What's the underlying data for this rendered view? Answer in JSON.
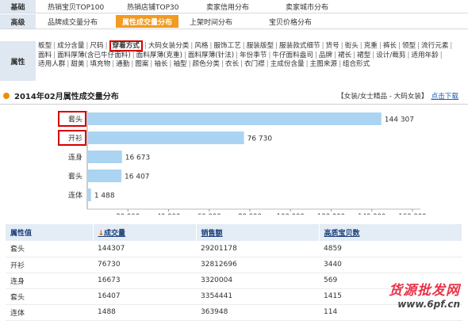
{
  "nav": {
    "row1": {
      "label": "基础",
      "items": [
        "热销宝贝TOP100",
        "热销店铺TOP30",
        "卖家信用分布",
        "卖家城市分布"
      ]
    },
    "row2": {
      "label": "高级",
      "items": [
        "品牌成交量分布",
        "属性成交量分布",
        "上架时间分布",
        "宝贝价格分布"
      ],
      "active_index": 1
    }
  },
  "attributes": {
    "label": "属性",
    "items": [
      "板型",
      "成分含量",
      "尺码",
      "穿着方式",
      "大码女装分类",
      "风格",
      "服饰工艺",
      "服装版型",
      "服装款式细节",
      "货号",
      "街头",
      "克重",
      "裤长",
      "领型",
      "流行元素",
      "面料",
      "面料厚薄(含已牛仔面料)",
      "面料厚薄(克重)",
      "面料厚薄(针法)",
      "年份季节",
      "牛仔面料盎司",
      "品牌",
      "裙长",
      "裙型",
      "设计/裁剪",
      "适用年龄",
      "适用人群",
      "甜美",
      "填充物",
      "通勤",
      "图案",
      "袖长",
      "袖型",
      "颜色分类",
      "衣长",
      "衣门襟",
      "主成份含量",
      "主图来源",
      "组合形式"
    ],
    "highlight_index": 3
  },
  "section": {
    "title": "2014年02月属性成交量分布",
    "breadcrumb": "【女装/女士精品 - 大码女装】",
    "download": "点击下载"
  },
  "chart_data": {
    "type": "bar",
    "orientation": "horizontal",
    "categories": [
      "套头",
      "开衫",
      "连身",
      "套头",
      "连体"
    ],
    "values": [
      144307,
      76730,
      16673,
      16407,
      1488
    ],
    "value_labels": [
      "144 307",
      "76 730",
      "16 673",
      "16 407",
      "1 488"
    ],
    "xlim": [
      0,
      160000
    ],
    "xticks": [
      20000,
      40000,
      60000,
      80000,
      100000,
      120000,
      140000,
      160000
    ],
    "xtick_labels": [
      "20 000",
      "40 000",
      "60 000",
      "80 000",
      "100 000",
      "120 000",
      "140 000",
      "160 000"
    ],
    "highlight_categories": [
      0,
      1
    ],
    "bar_color": "#aad4f2",
    "grid": false
  },
  "table": {
    "headers": [
      "属性值",
      "成交量",
      "销售额",
      "高质宝贝数"
    ],
    "sort_arrow": "↓",
    "rows": [
      [
        "套头",
        "144307",
        "29201178",
        "4859"
      ],
      [
        "开衫",
        "76730",
        "32812696",
        "3440"
      ],
      [
        "连身",
        "16673",
        "3320004",
        "569"
      ],
      [
        "套头",
        "16407",
        "3354441",
        "1415"
      ],
      [
        "连体",
        "1488",
        "363948",
        "114"
      ]
    ]
  },
  "watermark": {
    "cn": "货源批发网",
    "url": "www.6pf.cn"
  },
  "colors": {
    "accent": "#f29a21",
    "header_bg": "#dfe7f1",
    "highlight_border": "#d40000"
  }
}
